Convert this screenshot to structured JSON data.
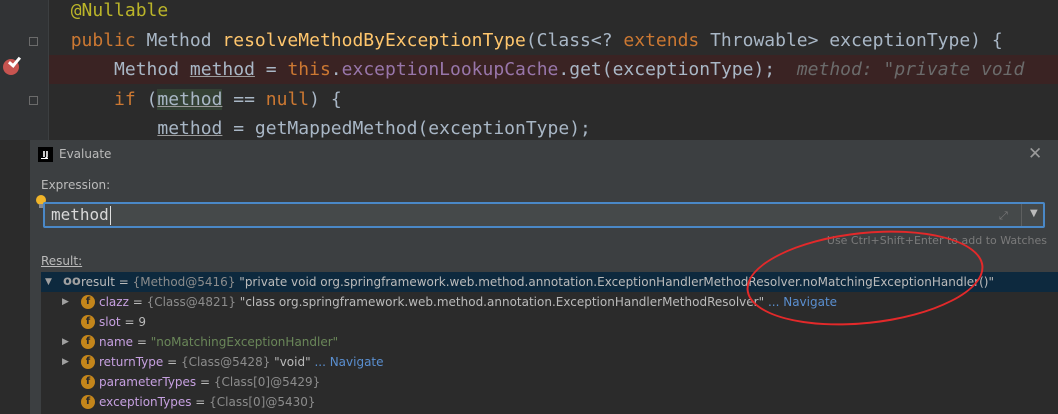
{
  "editor": {
    "lines": [
      {
        "indent": "",
        "parts": [
          {
            "t": "@Nullable",
            "c": "ann"
          }
        ]
      },
      {
        "indent": "",
        "parts": [
          {
            "t": "public ",
            "c": "kw"
          },
          {
            "t": "Method ",
            "c": ""
          },
          {
            "t": "resolveMethodByExceptionType",
            "c": "fn"
          },
          {
            "t": "(Class<? ",
            "c": ""
          },
          {
            "t": "extends ",
            "c": "kw"
          },
          {
            "t": "Throwable> exceptionType) {",
            "c": ""
          }
        ]
      },
      {
        "indent": "    ",
        "parts": [
          {
            "t": "Method ",
            "c": ""
          },
          {
            "t": "method",
            "c": "var"
          },
          {
            "t": " = ",
            "c": ""
          },
          {
            "t": "this",
            "c": "kw"
          },
          {
            "t": ".",
            "c": ""
          },
          {
            "t": "exceptionLookupCache",
            "c": "fld"
          },
          {
            "t": ".get(exceptionType);",
            "c": ""
          },
          {
            "t": "  method: \"private void",
            "c": "inl"
          }
        ]
      },
      {
        "indent": "    ",
        "parts": [
          {
            "t": "if ",
            "c": "kw"
          },
          {
            "t": "(",
            "c": ""
          },
          {
            "t": "method",
            "c": "hl var"
          },
          {
            "t": " == ",
            "c": ""
          },
          {
            "t": "null",
            "c": "kw"
          },
          {
            "t": ") {",
            "c": ""
          }
        ]
      },
      {
        "indent": "        ",
        "parts": [
          {
            "t": "method",
            "c": "var"
          },
          {
            "t": " = getMappedMethod(exceptionType);",
            "c": ""
          }
        ]
      }
    ]
  },
  "dialog": {
    "title": "Evaluate",
    "app_icon_text": "IJ",
    "close_label": "✕",
    "expression_label": "Expression:",
    "expression_value": "method",
    "watches_hint": "Use Ctrl+Shift+Enter to add to Watches",
    "result_label": "Result:",
    "icons": {
      "expand": "expand-icon",
      "dropdown": "chevron-down-icon",
      "bulb": "lightbulb-icon",
      "field": "field-icon",
      "breakpoint": "breakpoint-icon"
    }
  },
  "result": {
    "root": {
      "name": "result",
      "ref": "{Method@5416}",
      "value": "\"private void org.springframework.web.method.annotation.ExceptionHandlerMethodResolver.noMatchingExceptionHandler()\""
    },
    "fields": [
      {
        "name": "clazz",
        "ref": "{Class@4821}",
        "value": "\"class org.springframework.web.method.annotation.ExceptionHandlerMethodResolver\"",
        "nav": "... Navigate",
        "expandable": true,
        "kind": "ref"
      },
      {
        "name": "slot",
        "ref": "",
        "value": "9",
        "nav": "",
        "expandable": false,
        "kind": "plain"
      },
      {
        "name": "name",
        "ref": "",
        "value": "\"noMatchingExceptionHandler\"",
        "nav": "",
        "expandable": true,
        "kind": "str"
      },
      {
        "name": "returnType",
        "ref": "{Class@5428}",
        "value": "\"void\"",
        "nav": "... Navigate",
        "expandable": true,
        "kind": "ref"
      },
      {
        "name": "parameterTypes",
        "ref": "{Class[0]@5429}",
        "value": "",
        "nav": "",
        "expandable": false,
        "kind": "ref"
      },
      {
        "name": "exceptionTypes",
        "ref": "{Class[0]@5430}",
        "value": "",
        "nav": "",
        "expandable": false,
        "kind": "ref"
      }
    ]
  },
  "colors": {
    "accent": "#4a88c7",
    "selection": "#0d293e",
    "annotation": "#e3292a",
    "breakpoint_line": "#3a2323"
  }
}
